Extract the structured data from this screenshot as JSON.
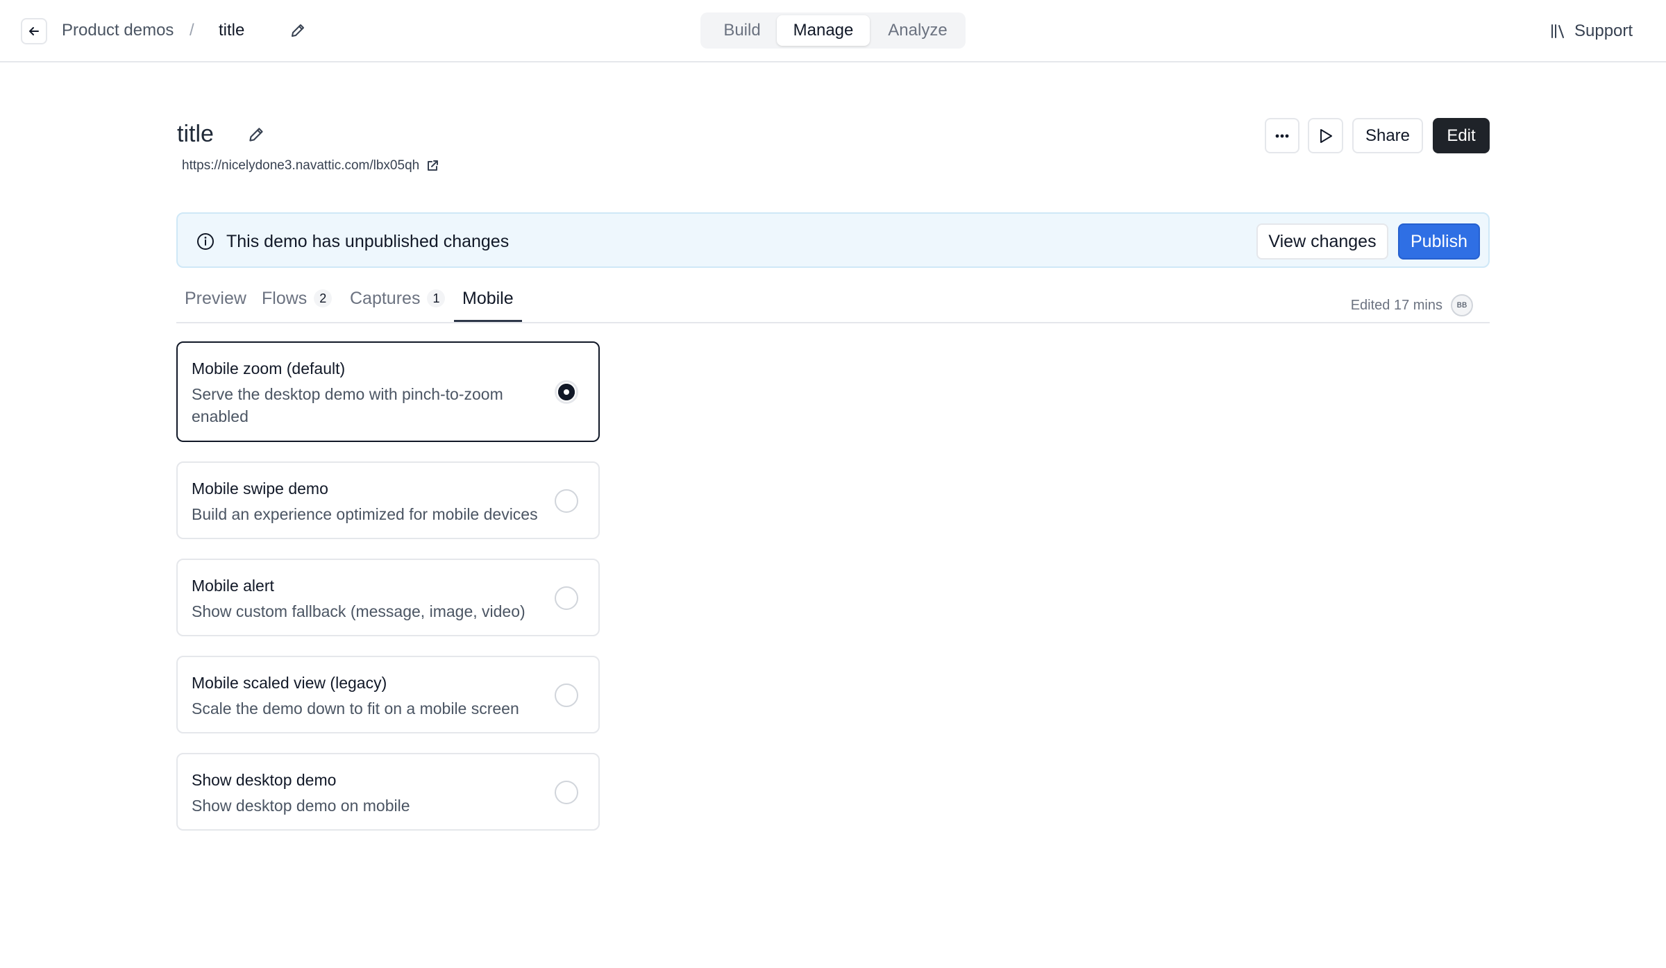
{
  "topbar": {
    "breadcrumb_parent": "Product demos",
    "breadcrumb_separator": "/",
    "breadcrumb_current": "title",
    "segments": [
      {
        "label": "Build",
        "active": false
      },
      {
        "label": "Manage",
        "active": true
      },
      {
        "label": "Analyze",
        "active": false
      }
    ],
    "support_label": "Support"
  },
  "header": {
    "title": "title",
    "url": "https://nicelydone3.navattic.com/lbx05qh",
    "share_label": "Share",
    "edit_label": "Edit"
  },
  "banner": {
    "message": "This demo has unpublished changes",
    "view_changes_label": "View changes",
    "publish_label": "Publish",
    "accent_color": "#2f6fe4"
  },
  "tabs": [
    {
      "label": "Preview",
      "count": null,
      "active": false
    },
    {
      "label": "Flows",
      "count": "2",
      "active": false
    },
    {
      "label": "Captures",
      "count": "1",
      "active": false
    },
    {
      "label": "Mobile",
      "count": null,
      "active": true
    }
  ],
  "edited": {
    "text": "Edited 17 mins",
    "avatar_initials": "BB"
  },
  "mobile_options": [
    {
      "title": "Mobile zoom (default)",
      "description": "Serve the desktop demo with pinch-to-zoom enabled",
      "selected": true
    },
    {
      "title": "Mobile swipe demo",
      "description": "Build an experience optimized for mobile devices",
      "selected": false
    },
    {
      "title": "Mobile alert",
      "description": "Show custom fallback (message, image, video)",
      "selected": false
    },
    {
      "title": "Mobile scaled view (legacy)",
      "description": "Scale the demo down to fit on a mobile screen",
      "selected": false
    },
    {
      "title": "Show desktop demo",
      "description": "Show desktop demo on mobile",
      "selected": false
    }
  ]
}
